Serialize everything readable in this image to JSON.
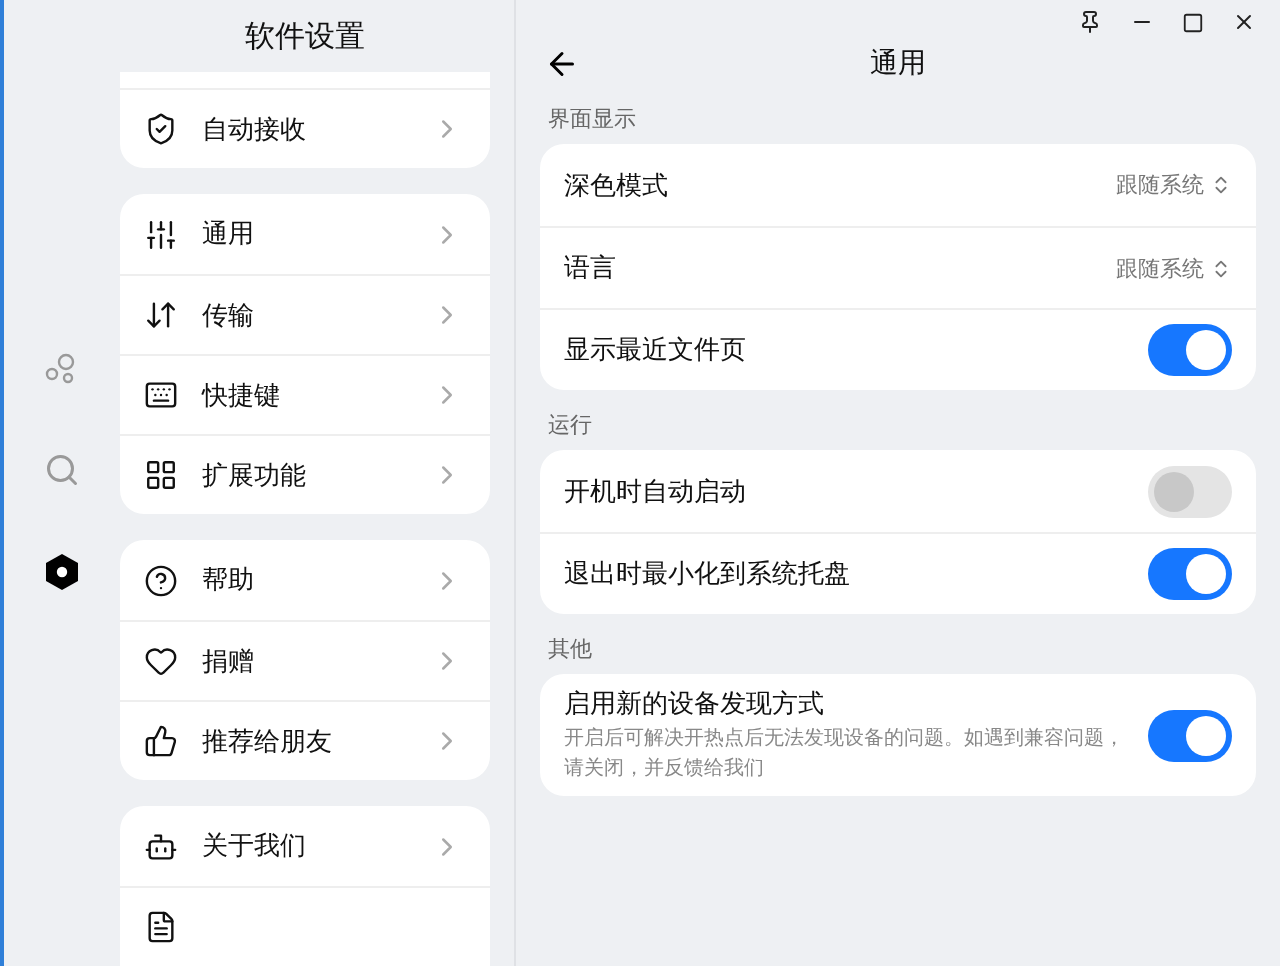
{
  "nav": [
    {
      "kind": "bubbles",
      "selected": false
    },
    {
      "kind": "search",
      "selected": false
    },
    {
      "kind": "settings",
      "selected": true
    }
  ],
  "left": {
    "title": "软件设置",
    "groups": [
      {
        "items": [
          {
            "kind": "shield",
            "label": "自动接收"
          }
        ]
      },
      {
        "items": [
          {
            "kind": "sliders",
            "label": "通用"
          },
          {
            "kind": "transfer",
            "label": "传输"
          },
          {
            "kind": "keyboard",
            "label": "快捷键"
          },
          {
            "kind": "grid",
            "label": "扩展功能"
          }
        ]
      },
      {
        "items": [
          {
            "kind": "help",
            "label": "帮助"
          },
          {
            "kind": "heart",
            "label": "捐赠"
          },
          {
            "kind": "thumb",
            "label": "推荐给朋友"
          }
        ]
      },
      {
        "items": [
          {
            "kind": "bot",
            "label": "关于我们"
          },
          {
            "kind": "doc"
          }
        ]
      }
    ]
  },
  "right": {
    "title": "通用",
    "sections": [
      {
        "heading": "界面显示",
        "rows": [
          {
            "kind": "select",
            "label": "深色模式",
            "value": "跟随系统"
          },
          {
            "kind": "select",
            "label": "语言",
            "value": "跟随系统"
          },
          {
            "kind": "toggle",
            "label": "显示最近文件页",
            "on": true,
            "disabled": false
          }
        ]
      },
      {
        "heading": "运行",
        "rows": [
          {
            "kind": "toggle",
            "label": "开机时自动启动",
            "on": false,
            "disabled": true
          },
          {
            "kind": "toggle",
            "label": "退出时最小化到系统托盘",
            "on": true,
            "disabled": false
          }
        ]
      },
      {
        "heading": "其他",
        "rows": [
          {
            "kind": "toggle",
            "label": "启用新的设备发现方式",
            "description": "开启后可解决开热点后无法发现设备的问题。如遇到兼容问题，请关闭，并反馈给我们",
            "on": true,
            "disabled": false
          }
        ]
      }
    ]
  }
}
